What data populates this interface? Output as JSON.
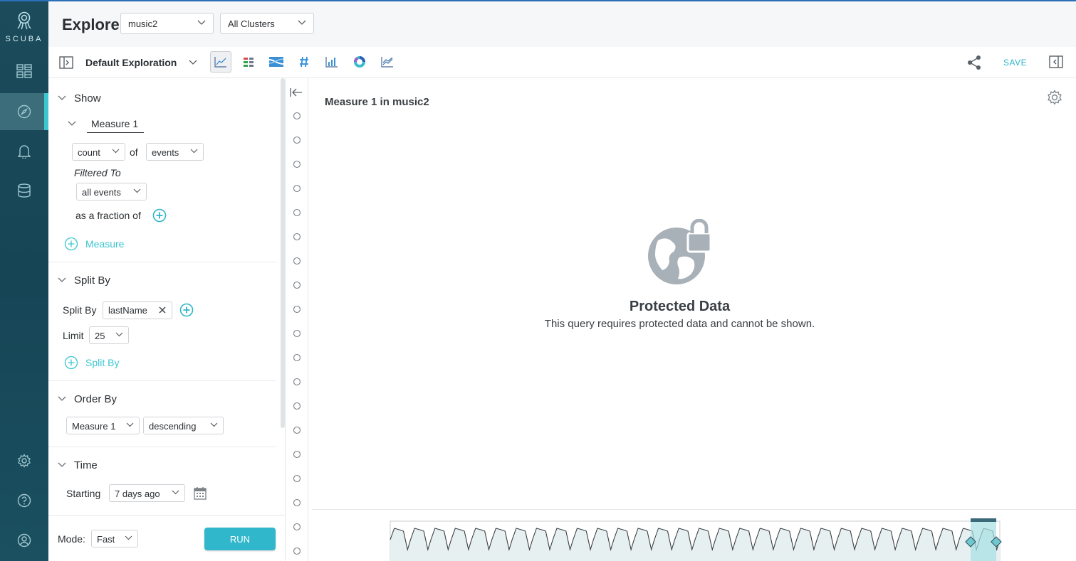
{
  "brand": {
    "name": "SCUBA"
  },
  "nav": {
    "items": [
      {
        "name": "dashboards",
        "icon": "grid-icon"
      },
      {
        "name": "explore",
        "icon": "compass-icon",
        "active": true
      },
      {
        "name": "alerts",
        "icon": "bell-icon"
      },
      {
        "name": "data",
        "icon": "database-icon"
      }
    ],
    "bottom": [
      {
        "name": "settings",
        "icon": "gear-icon"
      },
      {
        "name": "help",
        "icon": "help-icon"
      },
      {
        "name": "profile",
        "icon": "user-icon"
      }
    ]
  },
  "header": {
    "title": "Explore",
    "dataset": "music2",
    "cluster": "All Clusters"
  },
  "toolbar": {
    "exploration_name": "Default Exploration",
    "save_label": "SAVE",
    "view_types": [
      "line-chart-icon",
      "table-icon",
      "flow-icon",
      "number-icon",
      "bar-chart-icon",
      "donut-icon",
      "compare-icon"
    ]
  },
  "panel": {
    "show": {
      "title": "Show",
      "measure_name": "Measure 1",
      "aggregate": "count",
      "of_label": "of",
      "target": "events",
      "filtered_to_label": "Filtered To",
      "filter": "all events",
      "fraction_label": "as a fraction of",
      "add_measure_label": "Measure"
    },
    "split_by": {
      "title": "Split By",
      "label": "Split By",
      "chip": "lastName",
      "limit_label": "Limit",
      "limit_value": "25",
      "add_label": "Split By"
    },
    "order_by": {
      "title": "Order By",
      "field": "Measure 1",
      "direction": "descending"
    },
    "time": {
      "title": "Time",
      "starting_label": "Starting",
      "starting_value": "7 days ago"
    },
    "mode": {
      "label": "Mode:",
      "value": "Fast"
    },
    "run_label": "RUN"
  },
  "main": {
    "title": "Measure 1 in music2",
    "protected_title": "Protected Data",
    "protected_message": "This query requires protected data and cannot be shown."
  },
  "colors": {
    "accent": "#31b7cb",
    "nav_bg": "#164556",
    "icon_gray": "#a8b0b8"
  }
}
